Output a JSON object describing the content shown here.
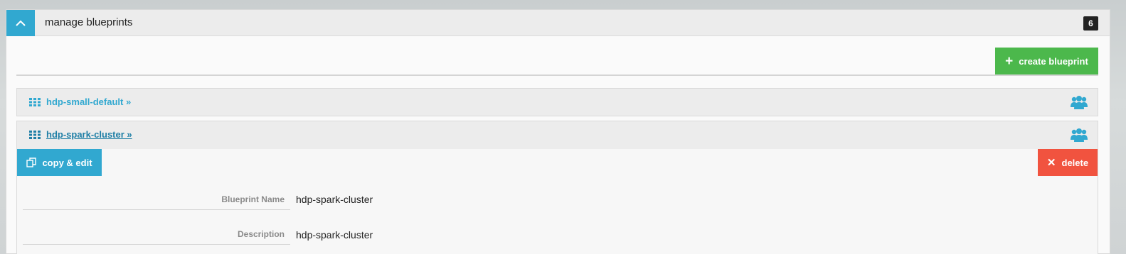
{
  "panel": {
    "title": "manage blueprints",
    "count": "6",
    "create_label": "create blueprint"
  },
  "blueprints": [
    {
      "name": "hdp-small-default »"
    },
    {
      "name": "hdp-spark-cluster »"
    }
  ],
  "details": {
    "copy_label": "copy & edit",
    "delete_label": "delete",
    "fields": [
      {
        "label": "Blueprint Name",
        "value": "hdp-spark-cluster"
      },
      {
        "label": "Description",
        "value": "hdp-spark-cluster"
      }
    ]
  },
  "colors": {
    "accent": "#31a8d0",
    "success": "#4cb84c",
    "danger": "#f1533f"
  },
  "icons": [
    "chevron-up-icon",
    "plus-icon",
    "grid-icon",
    "users-icon",
    "copy-icon",
    "close-icon"
  ]
}
